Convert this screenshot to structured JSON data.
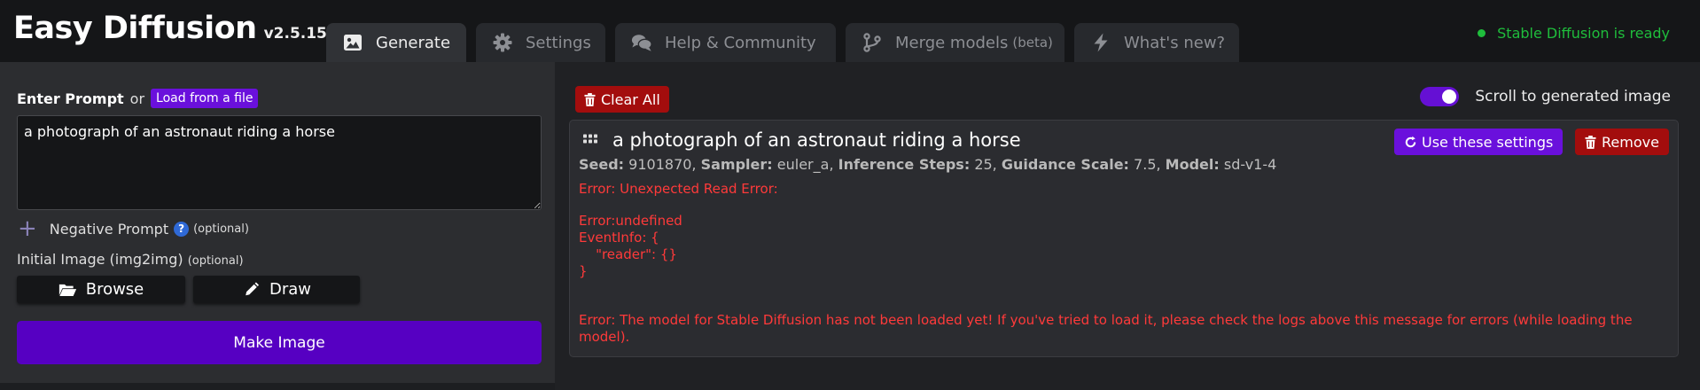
{
  "header": {
    "title": "Easy Diffusion",
    "version": "v2.5.15",
    "status": "Stable Diffusion is ready",
    "tabs": [
      {
        "label": "Generate",
        "icon": "image-icon"
      },
      {
        "label": "Settings",
        "icon": "gear-icon"
      },
      {
        "label": "Help & Community",
        "icon": "comments-icon"
      },
      {
        "label": "Merge models",
        "suffix": "(beta)",
        "icon": "merge-icon"
      },
      {
        "label": "What's new?",
        "icon": "lightning-icon"
      }
    ]
  },
  "editor": {
    "prompt_label": "Enter Prompt",
    "or_text": "or",
    "load_from_file": "Load from a file",
    "prompt_value": "a photograph of an astronaut riding a horse",
    "negative_label": "Negative Prompt",
    "negative_optional": "(optional)",
    "help_glyph": "?",
    "initial_image_label": "Initial Image (img2img)",
    "initial_image_optional": "(optional)",
    "browse_label": "Browse",
    "draw_label": "Draw",
    "make_image_label": "Make Image"
  },
  "output": {
    "clear_all_label": "Clear All",
    "scroll_label": "Scroll to generated image",
    "scroll_enabled": true,
    "task": {
      "prompt": "a photograph of an astronaut riding a horse",
      "use_settings_label": "Use these settings",
      "remove_label": "Remove",
      "meta": {
        "seed_label": "Seed:",
        "seed": "9101870,",
        "sampler_label": "Sampler:",
        "sampler": "euler_a,",
        "steps_label": "Inference Steps:",
        "steps": "25,",
        "guidance_label": "Guidance Scale:",
        "guidance": "7.5,",
        "model_label": "Model:",
        "model": "sd-v1-4"
      },
      "error_1": "Error: Unexpected Read Error:",
      "error_detail": "Error:undefined\nEventInfo: {\n    \"reader\": {}\n}",
      "error_2": "Error: The model for Stable Diffusion has not been loaded yet! If you've tried to load it, please check the logs above this message for errors (while loading the model)."
    }
  },
  "colors": {
    "accent": "#6a10dc",
    "make_button": "#5600c2",
    "danger": "#a30d0d",
    "ready": "#1fbd3c",
    "error": "#ff3a3a"
  }
}
